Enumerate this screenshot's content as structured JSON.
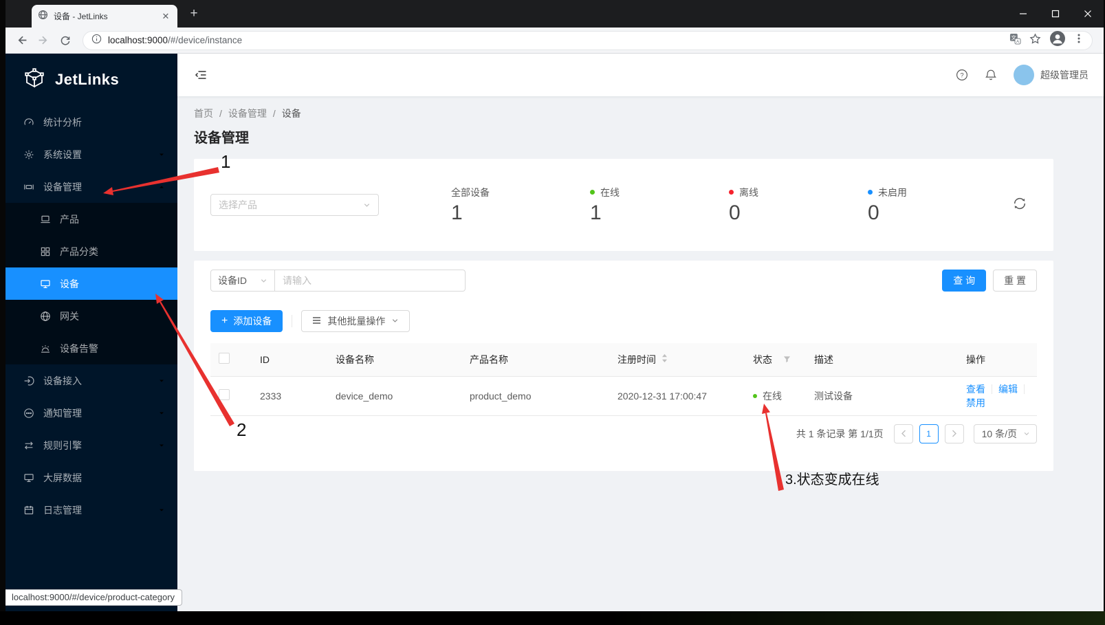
{
  "browser": {
    "tab_title": "设备 - JetLinks",
    "url_host": "localhost:9000",
    "url_path": "/#/device/instance",
    "status_link": "localhost:9000/#/device/product-category"
  },
  "sidebar": {
    "logo": "JetLinks",
    "items": [
      {
        "label": "统计分析"
      },
      {
        "label": "系统设置"
      },
      {
        "label": "设备管理"
      },
      {
        "label": "产品"
      },
      {
        "label": "产品分类"
      },
      {
        "label": "设备"
      },
      {
        "label": "网关"
      },
      {
        "label": "设备告警"
      },
      {
        "label": "设备接入"
      },
      {
        "label": "通知管理"
      },
      {
        "label": "规则引擎"
      },
      {
        "label": "大屏数据"
      },
      {
        "label": "日志管理"
      }
    ]
  },
  "header": {
    "user_name": "超级管理员"
  },
  "breadcrumb": {
    "home": "首页",
    "section": "设备管理",
    "current": "设备"
  },
  "page": {
    "title": "设备管理"
  },
  "stats": {
    "product_placeholder": "选择产品",
    "items": [
      {
        "label": "全部设备",
        "value": "1"
      },
      {
        "label": "在线",
        "value": "1",
        "dot_color": "#52c41a"
      },
      {
        "label": "离线",
        "value": "0",
        "dot_color": "#f5222d"
      },
      {
        "label": "未启用",
        "value": "0",
        "dot_color": "#1890ff"
      }
    ]
  },
  "search": {
    "field": "设备ID",
    "input_placeholder": "请输入",
    "query": "查 询",
    "reset": "重 置"
  },
  "toolbar": {
    "add_device": "添加设备",
    "batch_ops": "其他批量操作"
  },
  "table": {
    "columns": {
      "id": "ID",
      "device_name": "设备名称",
      "product_name": "产品名称",
      "register_time": "注册时间",
      "status": "状态",
      "description": "描述",
      "actions": "操作"
    },
    "row": {
      "id": "2333",
      "device_name": "device_demo",
      "product_name": "product_demo",
      "register_time": "2020-12-31 17:00:47",
      "status": "在线",
      "status_color": "#52c41a",
      "description": "测试设备",
      "action_view": "查看",
      "action_edit": "编辑",
      "action_disable": "禁用"
    }
  },
  "pagination": {
    "summary": "共 1 条记录 第 1/1页",
    "page": "1",
    "size": "10 条/页"
  },
  "annotations": {
    "step1": "1",
    "step2": "2",
    "step3": "3.状态变成在线"
  },
  "colors": {
    "accent": "#1890ff",
    "online": "#52c41a",
    "offline": "#f5222d",
    "not_enabled": "#1890ff",
    "arrow": "#e8312f",
    "sidebar": "#001529"
  }
}
